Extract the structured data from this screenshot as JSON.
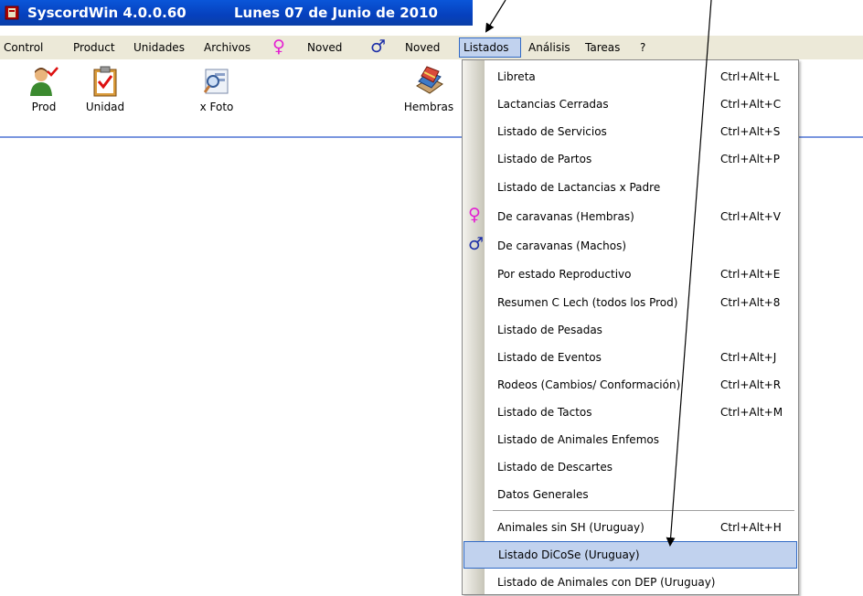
{
  "window": {
    "app_title": "SyscordWin 4.0.0.60",
    "date_title": "Lunes 07 de Junio de 2010"
  },
  "menubar": {
    "items": [
      "Control",
      "Product",
      "Unidades",
      "Archivos",
      "Noved",
      "Noved",
      "Listados",
      "Análisis",
      "Tareas",
      "?"
    ],
    "female_symbol": "♀",
    "male_symbol": "♂",
    "active_item": "Listados"
  },
  "toolbar": {
    "buttons": [
      {
        "label": "Prod",
        "icon": "person-check-icon"
      },
      {
        "label": "Unidad",
        "icon": "clipboard-check-icon"
      },
      {
        "label": "x Foto",
        "icon": "photo-search-icon"
      },
      {
        "label": "Hembras",
        "icon": "books-icon"
      }
    ]
  },
  "listados_menu": {
    "items": [
      {
        "label": "Libreta",
        "shortcut": "Ctrl+Alt+L"
      },
      {
        "label": "Lactancias Cerradas",
        "shortcut": "Ctrl+Alt+C"
      },
      {
        "label": "Listado de Servicios",
        "shortcut": "Ctrl+Alt+S"
      },
      {
        "label": "Listado de Partos",
        "shortcut": "Ctrl+Alt+P"
      },
      {
        "label": "Listado de Lactancias x Padre",
        "shortcut": ""
      },
      {
        "label": "De caravanas (Hembras)",
        "shortcut": "Ctrl+Alt+V",
        "icon": "female-icon"
      },
      {
        "label": "De caravanas (Machos)",
        "shortcut": "",
        "icon": "male-icon"
      },
      {
        "label": "Por estado Reproductivo",
        "shortcut": "Ctrl+Alt+E"
      },
      {
        "label": "Resumen C Lech (todos los Prod)",
        "shortcut": "Ctrl+Alt+8"
      },
      {
        "label": "Listado de Pesadas",
        "shortcut": ""
      },
      {
        "label": "Listado de Eventos",
        "shortcut": "Ctrl+Alt+J"
      },
      {
        "label": "Rodeos (Cambios/ Conformación)",
        "shortcut": "Ctrl+Alt+R"
      },
      {
        "label": "Listado de Tactos",
        "shortcut": "Ctrl+Alt+M"
      },
      {
        "label": "Listado de Animales Enfemos",
        "shortcut": ""
      },
      {
        "label": "Listado de Descartes",
        "shortcut": ""
      },
      {
        "label": "Datos Generales",
        "shortcut": ""
      },
      {
        "label": "Animales sin SH (Uruguay)",
        "shortcut": "Ctrl+Alt+H"
      },
      {
        "label": "Listado DiCoSe (Uruguay)",
        "shortcut": "",
        "highlighted": true
      },
      {
        "label": "Listado de Animales con DEP (Uruguay)",
        "shortcut": ""
      }
    ]
  },
  "colors": {
    "titlebar": "#0a4fd0",
    "menubar": "#ece9d8",
    "highlight": "#c1d2ee",
    "highlight_border": "#316ac5",
    "female": "#e41fd2",
    "male": "#1d2fa8"
  }
}
